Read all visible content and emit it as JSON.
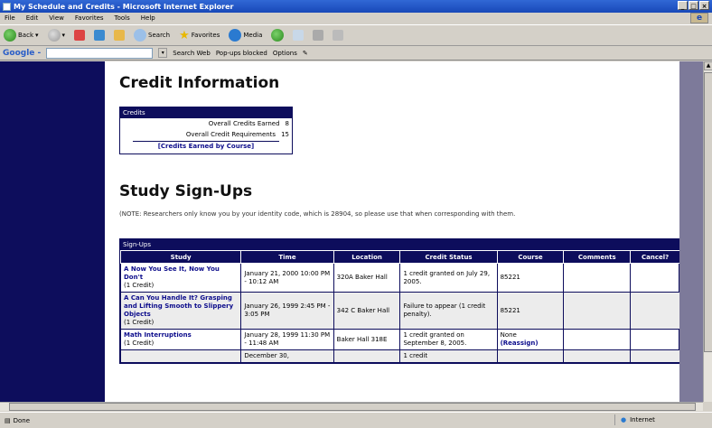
{
  "window": {
    "title": "My Schedule and Credits - Microsoft Internet Explorer",
    "controls": [
      "_",
      "□",
      "×"
    ]
  },
  "menu": [
    "File",
    "Edit",
    "View",
    "Favorites",
    "Tools",
    "Help"
  ],
  "toolbar": {
    "back": "Back",
    "search": "Search",
    "favorites": "Favorites",
    "media": "Media"
  },
  "googlebar": {
    "logo": "Google -",
    "search_web": "Search Web",
    "popups_blocked": "Pop-ups blocked",
    "options": "Options"
  },
  "page": {
    "credit_heading": "Credit Information",
    "credits_box": {
      "header": "Credits",
      "rows": [
        {
          "label": "Overall Credits Earned",
          "value": "8"
        },
        {
          "label": "Overall Credit Requirements",
          "value": "15"
        }
      ],
      "link": "[Credits Earned by Course]"
    },
    "signups_heading": "Study Sign-Ups",
    "note": "(NOTE: Researchers only know you by your identity code, which is 28904, so please use that when corresponding with them.",
    "signups": {
      "header": "Sign-Ups",
      "columns": [
        "Study",
        "Time",
        "Location",
        "Credit Status",
        "Course",
        "Comments",
        "Cancel?"
      ],
      "rows": [
        {
          "study": "A Now You See It, Now You Don't",
          "credit": "(1 Credit)",
          "time": "January 21, 2000 10:00 PM - 10:12 AM",
          "location": "320A Baker Hall",
          "status": "1 credit granted on July 29, 2005.",
          "course": "85221",
          "comments": "",
          "cancel": ""
        },
        {
          "study": "A Can You Handle It? Grasping and Lifting Smooth to Slippery Objects",
          "credit": "(1 Credit)",
          "time": "January 26, 1999 2:45 PM - 3:05 PM",
          "location": "342 C Baker Hall",
          "status": "Failure to appear (1 credit penalty).",
          "course": "85221",
          "comments": "",
          "cancel": ""
        },
        {
          "study": "Math Interruptions",
          "credit": "(1 Credit)",
          "time": "January 28, 1999 11:30 PM - 11:48 AM",
          "location": "Baker Hall 318E",
          "status": "1 credit granted on September 8, 2005.",
          "course": "None",
          "course_link": "(Reassign)",
          "comments": "",
          "cancel": ""
        },
        {
          "study": "",
          "credit": "",
          "time": "December 30,",
          "location": "",
          "status": "1 credit",
          "course": "",
          "comments": "",
          "cancel": ""
        }
      ]
    }
  },
  "status": {
    "left": "Done",
    "zone": "Internet"
  }
}
